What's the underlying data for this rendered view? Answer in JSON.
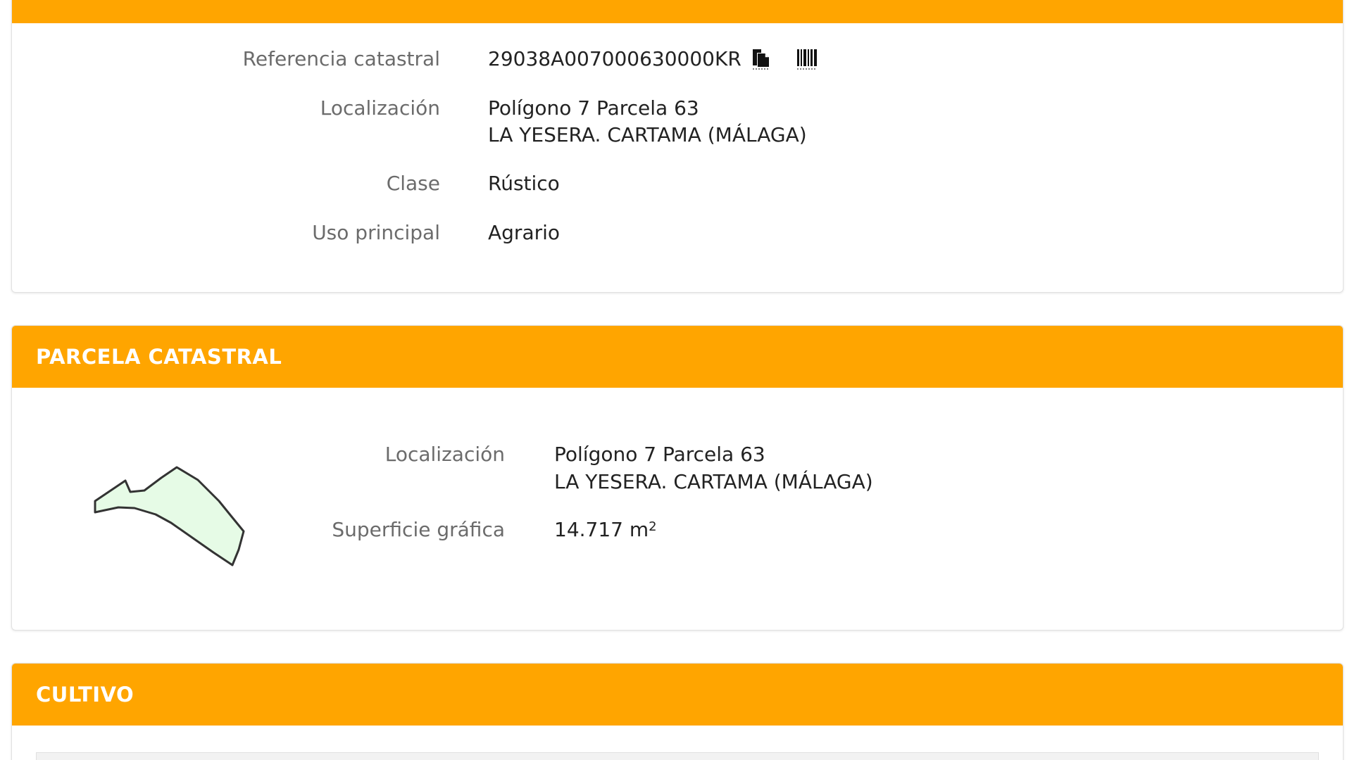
{
  "inmueble": {
    "referencia_label": "Referencia catastral",
    "referencia_value": "29038A007000630000KR",
    "localizacion_label": "Localización",
    "localizacion_line1": "Polígono 7 Parcela 63",
    "localizacion_line2": "LA YESERA. CARTAMA (MÁLAGA)",
    "clase_label": "Clase",
    "clase_value": "Rústico",
    "uso_label": "Uso principal",
    "uso_value": "Agrario",
    "copy_icon": "copy-icon",
    "barcode_icon": "barcode-icon"
  },
  "parcela": {
    "title": "PARCELA CATASTRAL",
    "localizacion_label": "Localización",
    "localizacion_line1": "Polígono 7 Parcela 63",
    "localizacion_line2": "LA YESERA. CARTAMA (MÁLAGA)",
    "superficie_label": "Superficie gráfica",
    "superficie_value": "14.717 m",
    "superficie_unit_sup": "2"
  },
  "cultivo": {
    "title": "CULTIVO"
  },
  "colors": {
    "header": "#ffa500",
    "parcel_fill": "#e6fbe6",
    "parcel_stroke": "#333333"
  }
}
